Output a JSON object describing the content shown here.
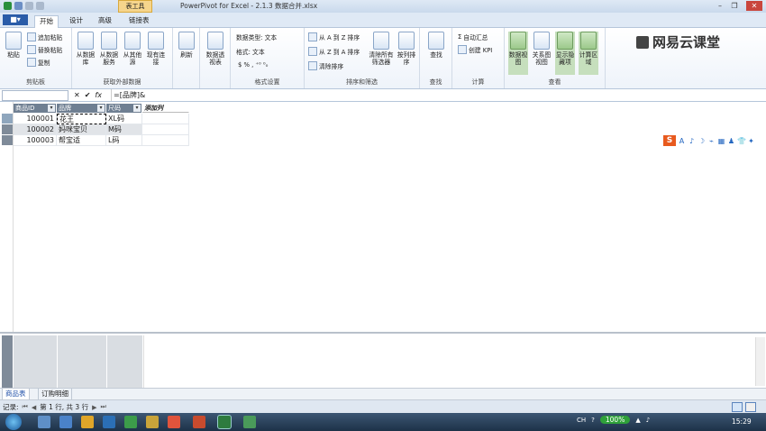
{
  "titlebar": {
    "table_tools": "表工具",
    "title": "PowerPivot for Excel - 2.1.3 数据合并.xlsx",
    "minimize": "–",
    "restore": "❐",
    "close": "✕"
  },
  "tabs": [
    "开始",
    "设计",
    "高级",
    "链接表"
  ],
  "file_tab": "■▾",
  "ribbon": {
    "clipboard": {
      "label": "剪贴板",
      "paste": "粘贴",
      "paste_append": "追加粘贴",
      "paste_replace": "替换粘贴",
      "copy": "复制"
    },
    "external": {
      "label": "获取外部数据",
      "from_db": "从数据库",
      "from_service": "从数据服务",
      "from_other": "从其他源",
      "existing": "现有连接"
    },
    "refresh": {
      "label": "刷新"
    },
    "pivot": {
      "label": "数据透视表"
    },
    "format": {
      "label": "格式设置",
      "datatype": "数据类型: 文本",
      "format": "格式: 文本",
      "symbols": "$  %  ,  ⁺⁰  ⁰₀"
    },
    "sort": {
      "label": "排序和筛选",
      "az": "从 A 到 Z 排序",
      "za": "从 Z 到 A 排序",
      "clear_sort": "清除排序",
      "clear_filter": "清除所有筛选器",
      "sort_by_col": "按列排序"
    },
    "find": {
      "label": "查找",
      "find": "查找"
    },
    "calc": {
      "label": "计算",
      "autosum": "自动汇总",
      "kpi": "创建 KPI"
    },
    "view": {
      "label": "查看",
      "data_view": "数据视图",
      "diagram_view": "关系图视图",
      "show_hidden": "显示隐藏项",
      "calc_area": "计算区域"
    }
  },
  "logo": "网易云课堂",
  "formula": {
    "namebox": "",
    "cancel": "✕",
    "confirm": "✔",
    "fx": "fx",
    "text": "=[品牌]&"
  },
  "columns": [
    "商品ID",
    "品牌",
    "尺码",
    "添加列"
  ],
  "rows": [
    {
      "id": "100001",
      "brand": "花王",
      "size": "XL码"
    },
    {
      "id": "100002",
      "brand": "妈咪宝贝",
      "size": "M码"
    },
    {
      "id": "100003",
      "brand": "帮宝适",
      "size": "L码"
    }
  ],
  "side_tools": [
    "A",
    "♪",
    "☽",
    "⌁",
    "▦",
    "♟",
    "👕",
    "✦"
  ],
  "sheets": [
    "商品表",
    "订购明细"
  ],
  "status": {
    "label": "记录:",
    "position": "第 1 行, 共 3 行",
    "first": "⏮",
    "prev": "◀",
    "next": "▶",
    "last": "⏭"
  },
  "taskbar": {
    "lang": "CH",
    "zoom": "100%",
    "time": "15:29"
  }
}
